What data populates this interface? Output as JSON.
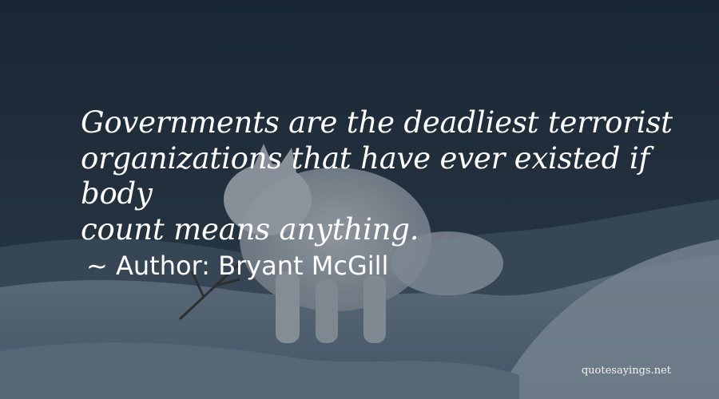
{
  "quote": {
    "lines": [
      "Governments are the deadliest terrorist",
      "organizations that have ever existed if body",
      "count means anything."
    ]
  },
  "author": {
    "prefix": "~",
    "label": "Author:",
    "name": "Bryant McGill"
  },
  "watermark": "quotesayings.net",
  "background": {
    "description_colors": {
      "sky": "#2a3745",
      "snow": "#9fb0c0",
      "fox": "#c7ced4"
    }
  }
}
